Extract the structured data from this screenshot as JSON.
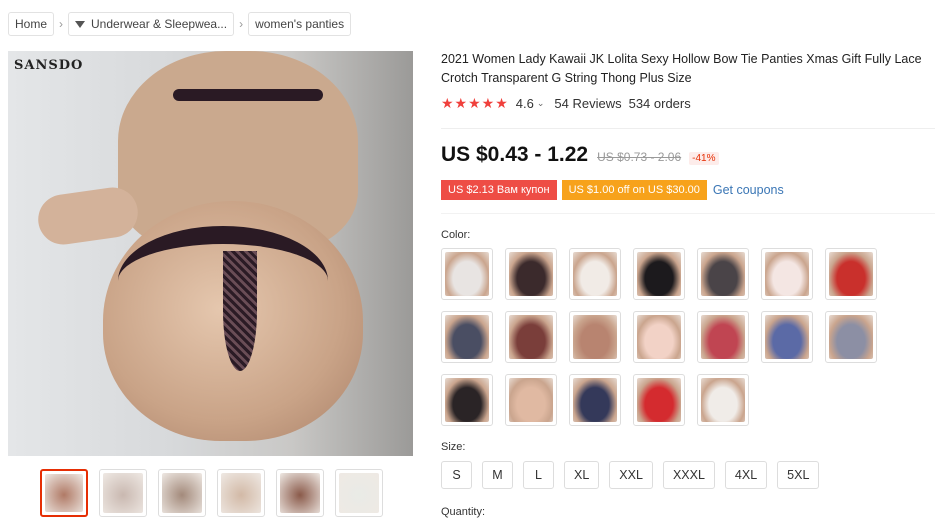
{
  "breadcrumb": {
    "items": [
      "Home",
      "Underwear & Sleepwea...",
      "women's panties"
    ],
    "separator": "›"
  },
  "gallery": {
    "logo": "SANSDO",
    "thumbnails": [
      {
        "color": "#b07a66",
        "selected": true
      },
      {
        "color": "#c9b8b0",
        "selected": false
      },
      {
        "color": "#a38a7b",
        "selected": false
      },
      {
        "color": "#d2b9a6",
        "selected": false
      },
      {
        "color": "#8a5a4a",
        "selected": false
      },
      {
        "color": "#e9ebe6",
        "selected": false
      }
    ]
  },
  "product": {
    "title": "2021 Women Lady Kawaii JK Lolita Sexy Hollow Bow Tie Panties Xmas Gift Fully Lace Crotch Transparent G String Thong Plus Size",
    "stars": "★★★★★",
    "rating": "4.6",
    "reviews": "54 Reviews",
    "orders": "534 orders",
    "price": "US $0.43 - 1.22",
    "old_price": "US $0.73 - 2.06",
    "discount": "-41%",
    "coupon_1": "US $2.13 Вам купон",
    "coupon_2": "US $1.00 off on US $30.00",
    "get_coupons": "Get coupons"
  },
  "colors_label": "Color:",
  "colors": [
    {
      "color": "#e8e4e2"
    },
    {
      "color": "#3b2a2c"
    },
    {
      "color": "#f1ebe6"
    },
    {
      "color": "#1c1a1d"
    },
    {
      "color": "#4a4448"
    },
    {
      "color": "#f4e6e3"
    },
    {
      "color": "#c9302c"
    },
    {
      "color": "#4a4e63"
    },
    {
      "color": "#7a3e3a"
    },
    {
      "color": "#b88470"
    },
    {
      "color": "#f2d2c6"
    },
    {
      "color": "#c04552"
    },
    {
      "color": "#5b6aa6"
    },
    {
      "color": "#8c8fa4"
    },
    {
      "color": "#2a2426"
    },
    {
      "color": "#e0b9a2"
    },
    {
      "color": "#34395a"
    },
    {
      "color": "#d42b2f"
    },
    {
      "color": "#f0ece8"
    }
  ],
  "size_label": "Size:",
  "sizes": [
    "S",
    "M",
    "L",
    "XL",
    "XXL",
    "XXXL",
    "4XL",
    "5XL"
  ],
  "quantity_label": "Quantity:"
}
